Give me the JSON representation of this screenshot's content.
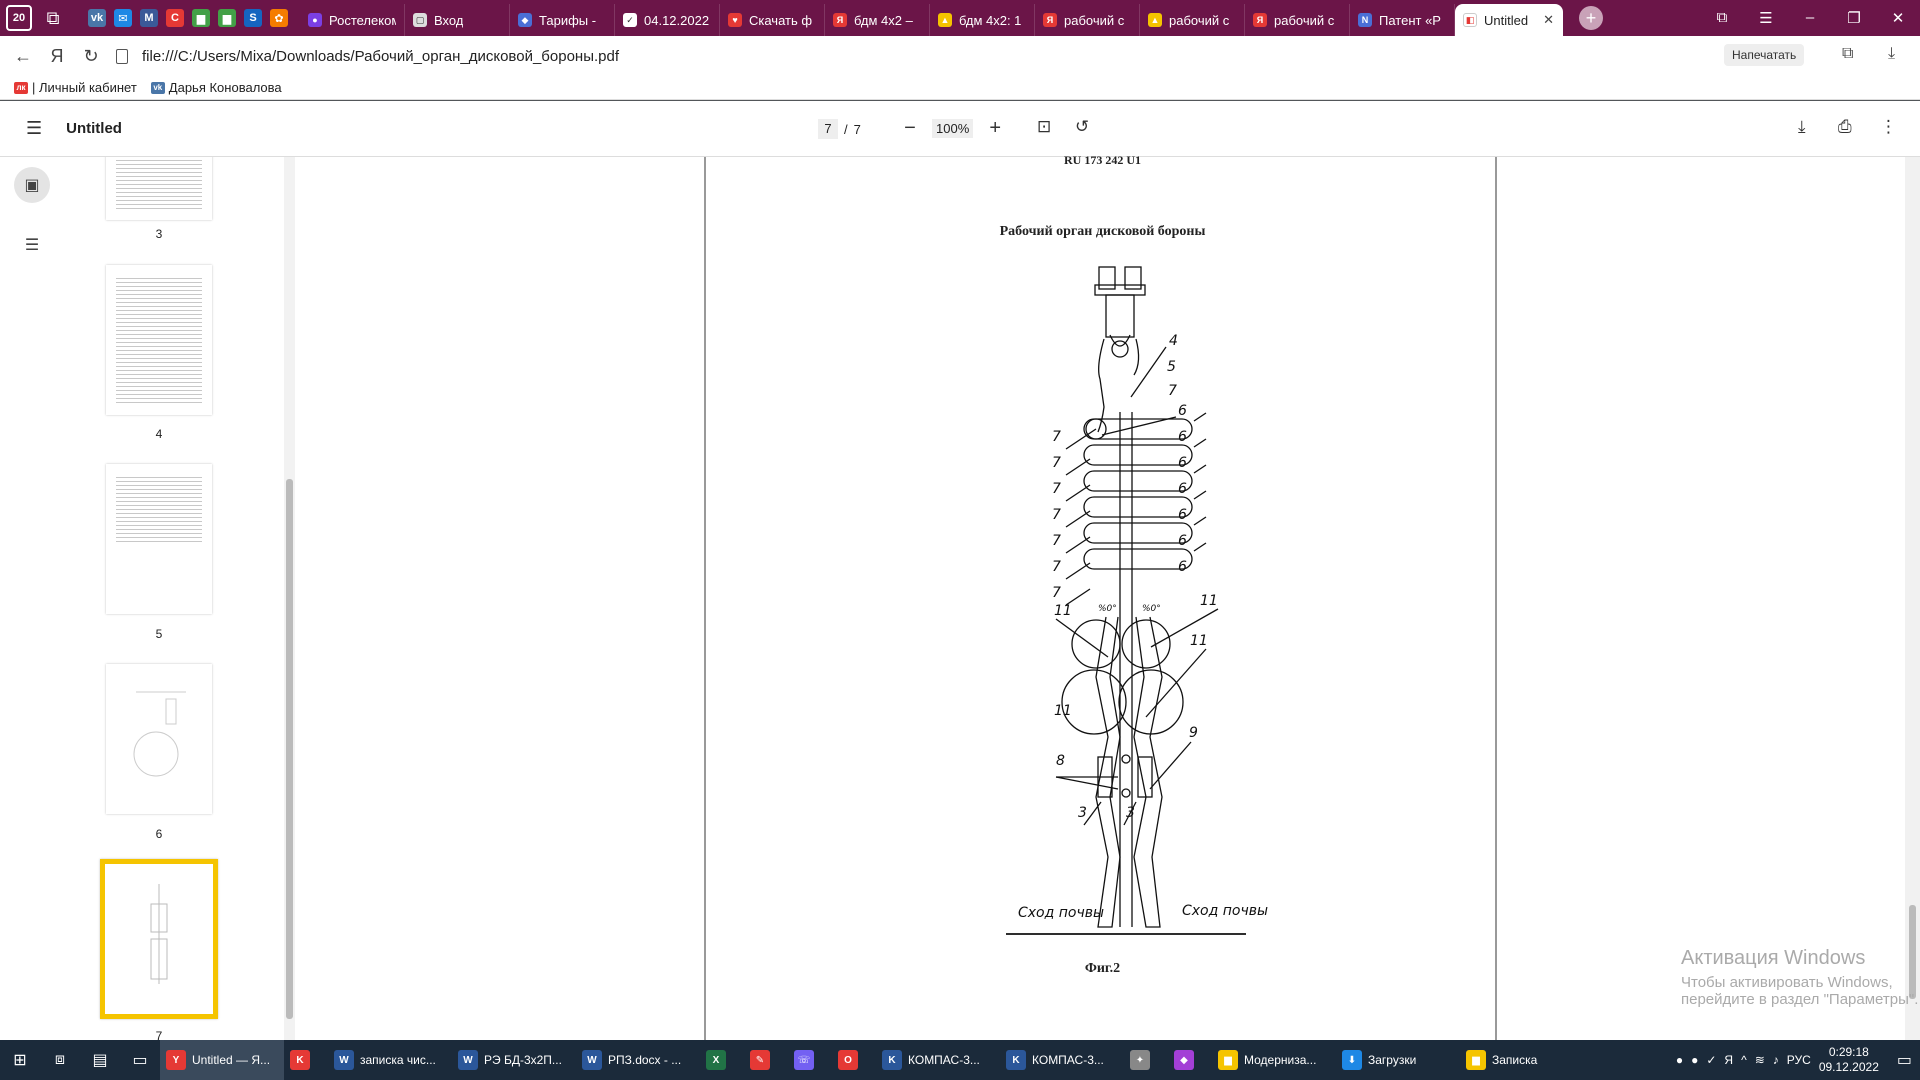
{
  "browser": {
    "sys_badge": "20",
    "tabs": [
      {
        "title": "Ростелеком",
        "color": "#7b3fe4",
        "glyph": "●"
      },
      {
        "title": "Вход",
        "color": "#ddd",
        "glyph": "▢"
      },
      {
        "title": "Тарифы -",
        "color": "#4a6fd6",
        "glyph": "◆"
      },
      {
        "title": "04.12.2022",
        "color": "#fff",
        "glyph": "✓"
      },
      {
        "title": "Скачать ф",
        "color": "#e53935",
        "glyph": "♥"
      },
      {
        "title": "бдм 4х2 –",
        "color": "#e53935",
        "glyph": "Я"
      },
      {
        "title": "бдм 4х2: 1",
        "color": "#f5c400",
        "glyph": "▲"
      },
      {
        "title": "рабочий с",
        "color": "#e53935",
        "glyph": "Я"
      },
      {
        "title": "рабочий с",
        "color": "#f5c400",
        "glyph": "▲"
      },
      {
        "title": "рабочий с",
        "color": "#e53935",
        "glyph": "Я"
      },
      {
        "title": "Патент «Р",
        "color": "#4a6fd6",
        "glyph": "N"
      }
    ],
    "active_tab": "Untitled",
    "url": "file:///C:/Users/Mixa/Downloads/Рабочий_орган_дисковой_бороны.pdf",
    "print_label": "Напечатать",
    "bookmarks": [
      {
        "label": "| Личный кабинет",
        "color": "#e53935",
        "glyph": "лк"
      },
      {
        "label": "Дарья Коновалова",
        "color": "#4a76a8",
        "glyph": "vk"
      }
    ]
  },
  "pdf": {
    "title": "Untitled",
    "current_page": "7",
    "total_pages": "7",
    "page_sep": "/",
    "zoom": "100%",
    "thumbnails": [
      {
        "label": "3"
      },
      {
        "label": "4"
      },
      {
        "label": "5"
      },
      {
        "label": "6"
      },
      {
        "label": "7"
      }
    ],
    "page": {
      "header": "RU    173 242  U1",
      "title": "Рабочий орган дисковой бороны",
      "figure": "Фиг.2",
      "soil_left": "Сход почвы",
      "soil_right": "Сход почвы",
      "angle": "%0°",
      "callouts": [
        "4",
        "5",
        "7",
        "6",
        "11",
        "9",
        "8",
        "3"
      ]
    }
  },
  "activation": {
    "title": "Активация Windows",
    "subtitle": "Чтобы активировать Windows, перейдите в раздел \"Параметры\"."
  },
  "taskbar": {
    "apps": [
      {
        "label": "Untitled — Я...",
        "color": "#e53935",
        "glyph": "Y"
      },
      {
        "label": "",
        "color": "#e53935",
        "glyph": "K"
      },
      {
        "label": "записка чис...",
        "color": "#2b579a",
        "glyph": "W"
      },
      {
        "label": "РЭ БД-3х2П...",
        "color": "#2b579a",
        "glyph": "W"
      },
      {
        "label": "РПЗ.docx - ...",
        "color": "#2b579a",
        "glyph": "W"
      },
      {
        "label": "",
        "color": "#217346",
        "glyph": "X"
      },
      {
        "label": "",
        "color": "#e53935",
        "glyph": "✎"
      },
      {
        "label": "",
        "color": "#7360f2",
        "glyph": "☏"
      },
      {
        "label": "",
        "color": "#e53935",
        "glyph": "O"
      },
      {
        "label": "КОМПАС-3...",
        "color": "#2b579a",
        "glyph": "K"
      },
      {
        "label": "КОМПАС-3...",
        "color": "#2b579a",
        "glyph": "K"
      },
      {
        "label": "",
        "color": "#888",
        "glyph": "✦"
      },
      {
        "label": "",
        "color": "#a33fd6",
        "glyph": "◆"
      },
      {
        "label": "Модерниза...",
        "color": "#f5c400",
        "glyph": "▆"
      },
      {
        "label": "Загрузки",
        "color": "#1e88e5",
        "glyph": "⬇"
      },
      {
        "label": "Записка",
        "color": "#f5c400",
        "glyph": "▆"
      }
    ],
    "lang": "РУС",
    "time": "0:29:18",
    "date": "09.12.2022"
  }
}
